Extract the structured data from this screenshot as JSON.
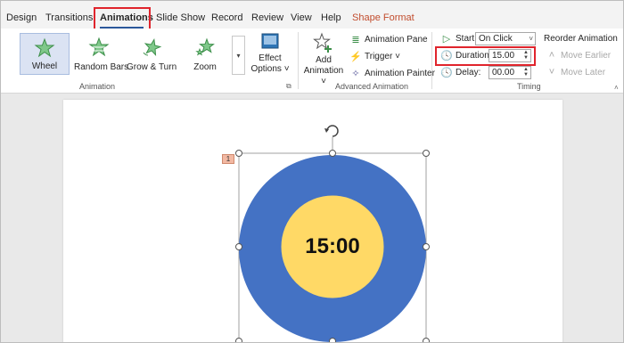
{
  "tabs": [
    {
      "label": "Design"
    },
    {
      "label": "Transitions"
    },
    {
      "label": "Animations"
    },
    {
      "label": "Slide Show"
    },
    {
      "label": "Record"
    },
    {
      "label": "Review"
    },
    {
      "label": "View"
    },
    {
      "label": "Help"
    },
    {
      "label": "Shape Format"
    }
  ],
  "animation_gallery": {
    "effects": [
      {
        "label": "Wheel",
        "icon": "wheel-star-icon",
        "selected": true
      },
      {
        "label": "Random Bars",
        "icon": "random-bars-star-icon"
      },
      {
        "label": "Grow & Turn",
        "icon": "grow-turn-star-icon"
      },
      {
        "label": "Zoom",
        "icon": "zoom-star-icon"
      }
    ],
    "effect_options": {
      "line1": "Effect",
      "line2": "Options ˅"
    },
    "group_label": "Animation"
  },
  "advanced_animation": {
    "add_animation": {
      "line1": "Add",
      "line2": "Animation ˅"
    },
    "animation_pane": "Animation Pane",
    "trigger": "Trigger ˅",
    "animation_painter": "Animation Painter",
    "group_label": "Advanced Animation"
  },
  "timing": {
    "start_label": "Start:",
    "start_value": "On Click",
    "duration_label": "Duration:",
    "duration_value": "15.00",
    "delay_label": "Delay:",
    "delay_value": "00.00",
    "reorder_title": "Reorder Animation",
    "move_earlier": "Move Earlier",
    "move_later": "Move Later",
    "group_label": "Timing"
  },
  "slide": {
    "animation_tag": "1",
    "timer_text": "15:00"
  },
  "colors": {
    "accent_red": "#e0242c",
    "outer_circle": "#4472c4",
    "inner_circle": "#ffd966",
    "shape_format_tab": "#c24d2e"
  }
}
